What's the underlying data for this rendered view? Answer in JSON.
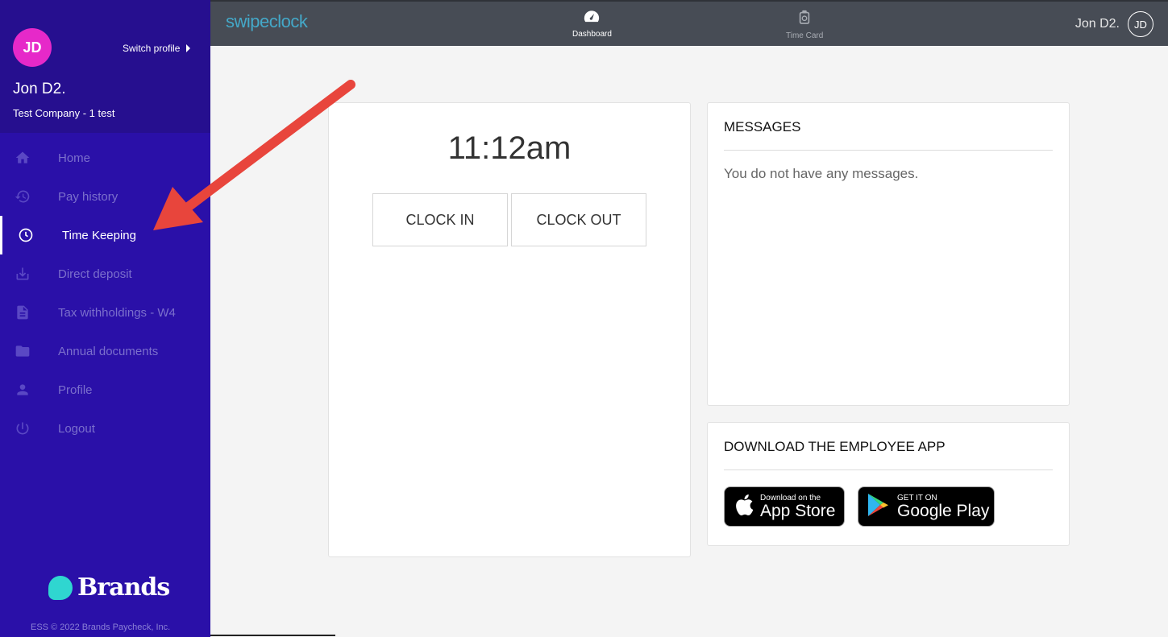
{
  "sidebar": {
    "avatar_initials": "JD",
    "switch_profile_label": "Switch profile",
    "user_name": "Jon D2.",
    "company": "Test Company - 1 test",
    "items": [
      {
        "label": "Home",
        "icon": "home-icon",
        "active": false
      },
      {
        "label": "Pay history",
        "icon": "history-icon",
        "active": false
      },
      {
        "label": "Time Keeping",
        "icon": "clock-icon",
        "active": true
      },
      {
        "label": "Direct deposit",
        "icon": "download-icon",
        "active": false
      },
      {
        "label": "Tax withholdings - W4",
        "icon": "document-icon",
        "active": false
      },
      {
        "label": "Annual documents",
        "icon": "folder-icon",
        "active": false
      },
      {
        "label": "Profile",
        "icon": "person-icon",
        "active": false
      },
      {
        "label": "Logout",
        "icon": "power-icon",
        "active": false
      }
    ],
    "brand_name": "Brands",
    "footer": "ESS © 2022 Brands Paycheck, Inc."
  },
  "topbar": {
    "logo": "swipeclock",
    "nav": [
      {
        "label": "Dashboard",
        "icon": "dashboard-icon",
        "active": true
      },
      {
        "label": "Time Card",
        "icon": "timecard-icon",
        "active": false
      }
    ],
    "user_name": "Jon D2.",
    "user_initials": "JD"
  },
  "clock": {
    "time": "11:12am",
    "clock_in_label": "CLOCK IN",
    "clock_out_label": "CLOCK OUT"
  },
  "messages": {
    "title": "MESSAGES",
    "empty_text": "You do not have any messages."
  },
  "app_download": {
    "title": "DOWNLOAD THE EMPLOYEE APP",
    "app_store": {
      "small": "Download on the",
      "big": "App Store"
    },
    "google_play": {
      "small": "GET IT ON",
      "big": "Google Play"
    }
  },
  "colors": {
    "sidebar_bg": "#2a10a8",
    "sidebar_head_bg": "#260f8f",
    "avatar_bg": "#e629c9",
    "topbar_bg": "#474c55",
    "annotation_arrow": "#e8453c"
  }
}
